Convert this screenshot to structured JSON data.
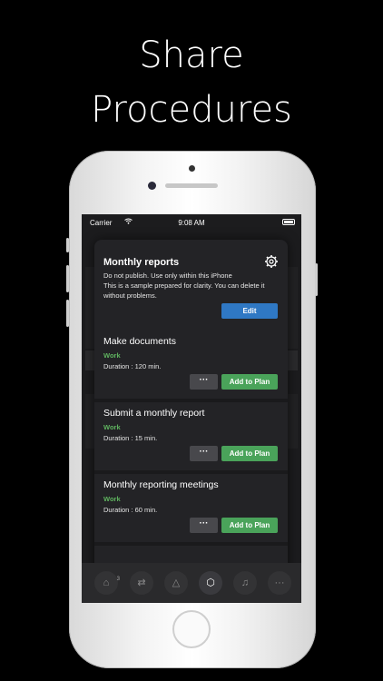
{
  "headline": {
    "line1": "Share",
    "line2": "Procedures"
  },
  "status_bar": {
    "carrier": "Carrier",
    "wifi_icon": "wifi-icon",
    "time": "9:08 AM"
  },
  "sheet": {
    "title": "Monthly reports",
    "gear_icon": "gear-icon",
    "description_line1": "Do not publish. Use only within this iPhone",
    "description_line2": "This is a sample prepared for clarity. You can delete it without problems.",
    "edit_label": "Edit"
  },
  "tasks": [
    {
      "name": "Make documents",
      "tag": "Work",
      "duration": "Duration : 120 min.",
      "more_label": "···",
      "add_label": "Add to Plan"
    },
    {
      "name": "Submit a monthly report",
      "tag": "Work",
      "duration": "Duration : 15 min.",
      "more_label": "···",
      "add_label": "Add to Plan"
    },
    {
      "name": "Monthly reporting meetings",
      "tag": "Work",
      "duration": "Duration : 60 min.",
      "more_label": "···",
      "add_label": "Add to Plan"
    }
  ],
  "tabbar": {
    "items": [
      {
        "icon": "tag-icon",
        "glyph": "⌂",
        "badge": "3"
      },
      {
        "icon": "repeat-icon",
        "glyph": "⇄"
      },
      {
        "icon": "triangle-icon",
        "glyph": "△"
      },
      {
        "icon": "procedure-icon",
        "glyph": "⬡"
      },
      {
        "icon": "music-icon",
        "glyph": "♫"
      },
      {
        "icon": "more-icon",
        "glyph": "···"
      }
    ]
  },
  "colors": {
    "accent_blue": "#2f78c4",
    "accent_green": "#4aa35a",
    "tag_green": "#5fb35f"
  }
}
